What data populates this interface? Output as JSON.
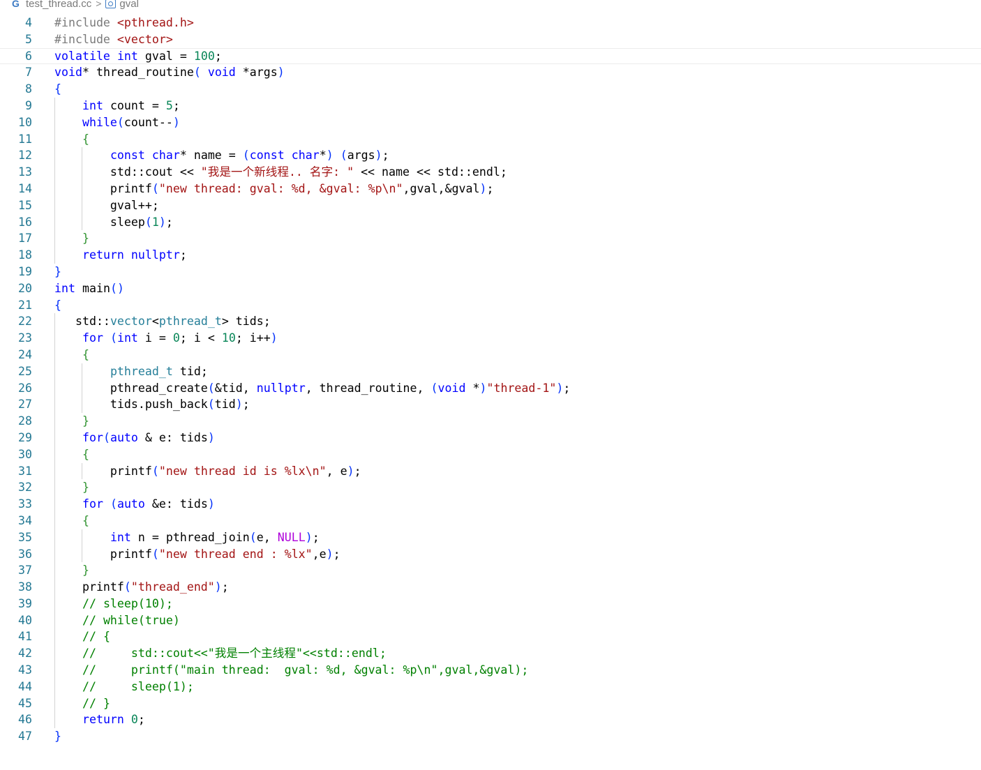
{
  "breadcrumb": {
    "file": "test_thread.cc",
    "symbol": "gval",
    "separator": ">"
  },
  "editor": {
    "current_line": 6,
    "lines": [
      {
        "n": "4",
        "t": "#include <pthread.h>"
      },
      {
        "n": "5",
        "t": "#include <vector>"
      },
      {
        "n": "6",
        "t": "volatile int gval = 100;"
      },
      {
        "n": "7",
        "t": "void* thread_routine( void *args)"
      },
      {
        "n": "8",
        "t": "{"
      },
      {
        "n": "9",
        "t": "    int count = 5;"
      },
      {
        "n": "10",
        "t": "    while(count--)"
      },
      {
        "n": "11",
        "t": "    {"
      },
      {
        "n": "12",
        "t": "        const char* name = (const char*) (args);"
      },
      {
        "n": "13",
        "t": "        std::cout << \"我是一个新线程.. 名字: \" << name << std::endl;"
      },
      {
        "n": "14",
        "t": "        printf(\"new thread: gval: %d, &gval: %p\\n\",gval,&gval);"
      },
      {
        "n": "15",
        "t": "        gval++;"
      },
      {
        "n": "16",
        "t": "        sleep(1);"
      },
      {
        "n": "17",
        "t": "    }"
      },
      {
        "n": "18",
        "t": "    return nullptr;"
      },
      {
        "n": "19",
        "t": "}"
      },
      {
        "n": "20",
        "t": "int main()"
      },
      {
        "n": "21",
        "t": "{"
      },
      {
        "n": "22",
        "t": "   std::vector<pthread_t> tids;"
      },
      {
        "n": "23",
        "t": "    for (int i = 0; i < 10; i++)"
      },
      {
        "n": "24",
        "t": "    {"
      },
      {
        "n": "25",
        "t": "        pthread_t tid;"
      },
      {
        "n": "26",
        "t": "        pthread_create(&tid, nullptr, thread_routine, (void *)\"thread-1\");"
      },
      {
        "n": "27",
        "t": "        tids.push_back(tid);"
      },
      {
        "n": "28",
        "t": "    }"
      },
      {
        "n": "29",
        "t": "    for(auto & e: tids)"
      },
      {
        "n": "30",
        "t": "    {"
      },
      {
        "n": "31",
        "t": "        printf(\"new thread id is %lx\\n\", e);"
      },
      {
        "n": "32",
        "t": "    }"
      },
      {
        "n": "33",
        "t": "    for (auto &e: tids)"
      },
      {
        "n": "34",
        "t": "    {"
      },
      {
        "n": "35",
        "t": "        int n = pthread_join(e, NULL);"
      },
      {
        "n": "36",
        "t": "        printf(\"new thread end : %lx\",e);"
      },
      {
        "n": "37",
        "t": "    }"
      },
      {
        "n": "38",
        "t": "    printf(\"thread_end\");"
      },
      {
        "n": "39",
        "t": "    // sleep(10);"
      },
      {
        "n": "40",
        "t": "    // while(true)"
      },
      {
        "n": "41",
        "t": "    // {"
      },
      {
        "n": "42",
        "t": "    //     std::cout<<\"我是一个主线程\"<<std::endl;"
      },
      {
        "n": "43",
        "t": "    //     printf(\"main thread:  gval: %d, &gval: %p\\n\",gval,&gval);"
      },
      {
        "n": "44",
        "t": "    //     sleep(1);"
      },
      {
        "n": "45",
        "t": "    // }"
      },
      {
        "n": "46",
        "t": "    return 0;"
      },
      {
        "n": "47",
        "t": "}"
      }
    ]
  },
  "colors": {
    "keyword": "#0000ff",
    "type": "#267f99",
    "string": "#a31515",
    "number": "#098658",
    "comment": "#008000",
    "line_number": "#237893",
    "macro": "#af00db"
  }
}
